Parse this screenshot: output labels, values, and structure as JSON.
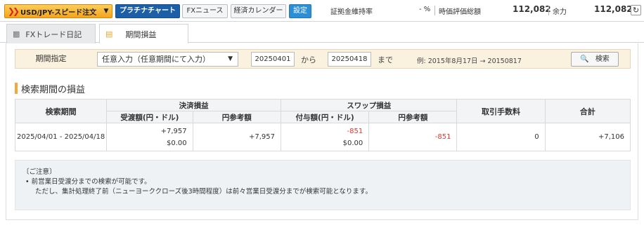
{
  "topbar": {
    "order_label": "USD/JPY-スピード注文",
    "platinum_label": "プラチナチャート",
    "news_label": "FXニュース",
    "calendar_label": "経済カレンダー",
    "settings_label": "設定",
    "margin_rate_label": "証拠金維持率",
    "margin_rate_value": "- %",
    "valuation_label": "時価評価総額",
    "valuation_value": "112,082",
    "available_label": "余力",
    "available_value": "112,082"
  },
  "tabs": [
    {
      "label": "FXトレード日記",
      "icon": "book-icon"
    },
    {
      "label": "期間損益",
      "icon": "document-icon"
    }
  ],
  "search": {
    "period_label": "期間指定",
    "period_select": "任意入力（任意期間にて入力）",
    "from_date": "20250401",
    "from_text": "から",
    "to_date": "20250418",
    "to_text": "まで",
    "example": "例: 2015年8月17日 → 20150817",
    "search_button": "検索"
  },
  "section_title": "検索期間の損益",
  "table": {
    "h_period": "検索期間",
    "h_settle": "決済損益",
    "h_swap": "スワップ損益",
    "h_fee": "取引手数料",
    "h_total": "合計",
    "h_settle_recv": "受渡額(円・ドル)",
    "h_settle_ref": "円参考額",
    "h_swap_grant": "付与額(円・ドル)",
    "h_swap_ref": "円参考額",
    "row": {
      "period": "2025/04/01 - 2025/04/18",
      "settle_jpy": "+7,957",
      "settle_usd": "$0.00",
      "settle_ref": "+7,957",
      "swap_jpy": "-851",
      "swap_usd": "$0.00",
      "swap_ref": "-851",
      "fee": "0",
      "total": "+7,106"
    }
  },
  "note": {
    "title": "〔ご注意〕",
    "line1": "前営業日受渡分までの検索が可能です。",
    "line2": "ただし、集計処理終了前（ニューヨーククローズ後3時間程度）は前々営業日受渡分までが検索可能となります。"
  },
  "colors": {
    "accent_orange": "#f4a41a",
    "platinum_blue": "#1d5fa7",
    "negative_red": "#e03a2f"
  }
}
